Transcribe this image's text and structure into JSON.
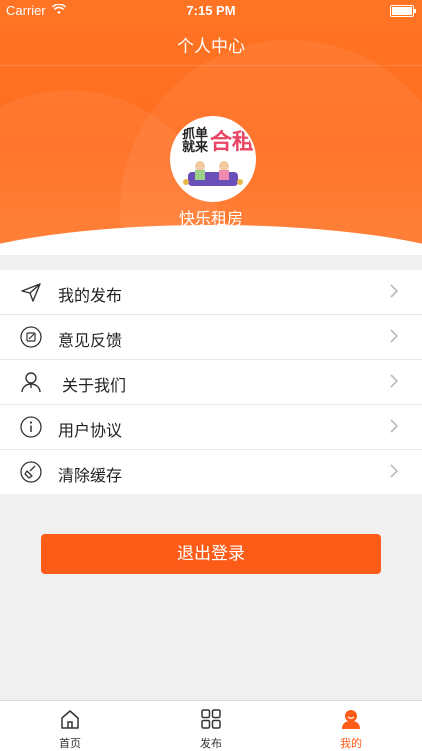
{
  "status": {
    "carrier": "Carrier",
    "time": "7:15 PM"
  },
  "nav": {
    "title": "个人中心"
  },
  "profile": {
    "username": "快乐租房",
    "avatar_brand_line1": "抓单",
    "avatar_brand_line2": "就来",
    "avatar_brand_big": "合租"
  },
  "menu": {
    "items": [
      {
        "label": "我的发布",
        "icon": "send-icon"
      },
      {
        "label": "意见反馈",
        "icon": "feedback-icon"
      },
      {
        "label": "关于我们",
        "icon": "person-icon"
      },
      {
        "label": "用户协议",
        "icon": "info-icon"
      },
      {
        "label": "清除缓存",
        "icon": "broom-icon"
      }
    ]
  },
  "logout": {
    "label": "退出登录"
  },
  "tabs": [
    {
      "label": "首页",
      "icon": "home-icon",
      "active": false
    },
    {
      "label": "发布",
      "icon": "grid-icon",
      "active": false
    },
    {
      "label": "我的",
      "icon": "user-icon",
      "active": true
    }
  ],
  "colors": {
    "accent": "#fd5b18",
    "header": "#ff7424"
  }
}
